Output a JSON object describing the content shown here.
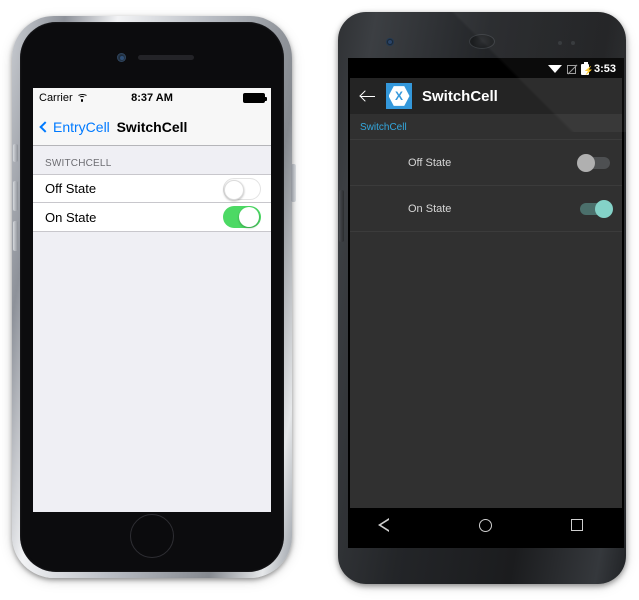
{
  "ios": {
    "status_bar": {
      "carrier": "Carrier",
      "wifi_icon": "wifi-icon",
      "time": "8:37 AM",
      "battery_icon": "battery-full-icon"
    },
    "nav_bar": {
      "back_label": "EntryCell",
      "back_chevron_icon": "chevron-left-icon",
      "title": "SwitchCell"
    },
    "section_header": "SWITCHCELL",
    "rows": [
      {
        "label": "Off State",
        "switch_state": "off"
      },
      {
        "label": "On State",
        "switch_state": "on"
      }
    ],
    "home_button_icon": "home-button-icon",
    "colors": {
      "tint": "#007aff",
      "switch_on": "#4cd964",
      "background": "#efeff4",
      "bar": "#f7f7f7"
    }
  },
  "android": {
    "status_bar": {
      "wifi_icon": "wifi-icon",
      "signal_icon": "signal-off-icon",
      "battery_icon": "battery-charging-icon",
      "time": "3:53"
    },
    "app_bar": {
      "back_icon": "arrow-back-icon",
      "logo_icon": "xamarin-logo-icon",
      "logo_letter": "X",
      "title": "SwitchCell"
    },
    "section_header": "SwitchCell",
    "rows": [
      {
        "label": "Off State",
        "switch_state": "off"
      },
      {
        "label": "On State",
        "switch_state": "on"
      }
    ],
    "nav_bar": {
      "back_icon": "nav-back-icon",
      "home_icon": "nav-home-icon",
      "recents_icon": "nav-recents-icon"
    },
    "colors": {
      "accent": "#33a7dd",
      "logo_blue": "#3498db",
      "switch_on_thumb": "#84d2c8",
      "background": "#303030",
      "bar": "#242424"
    }
  }
}
